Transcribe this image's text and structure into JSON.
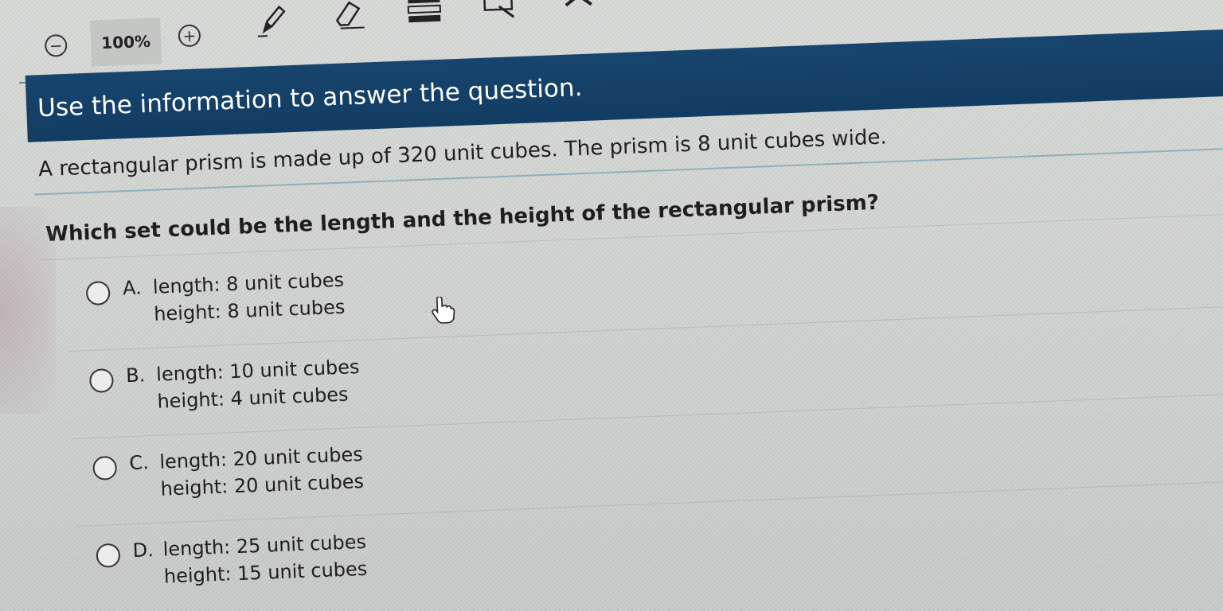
{
  "toolbar": {
    "zoom_level": "100%",
    "zoom_out_symbol": "−",
    "zoom_in_symbol": "+",
    "tools": [
      "pencil-icon",
      "eraser-icon",
      "line-reader-icon",
      "annotate-icon",
      "close-icon"
    ]
  },
  "banner": {
    "text": "Use the information to answer the question."
  },
  "info": {
    "text": "A rectangular prism is made up of 320 unit cubes. The prism is 8 unit cubes wide."
  },
  "question": {
    "text": "Which set could be the length and the height of the rectangular prism?"
  },
  "choices": [
    {
      "letter": "A.",
      "line1": "length: 8 unit cubes",
      "line2": "height: 8 unit cubes"
    },
    {
      "letter": "B.",
      "line1": "length: 10 unit cubes",
      "line2": "height: 4 unit cubes"
    },
    {
      "letter": "C.",
      "line1": "length: 20 unit cubes",
      "line2": "height: 20 unit cubes"
    },
    {
      "letter": "D.",
      "line1": "length: 25 unit cubes",
      "line2": "height: 15 unit cubes"
    }
  ],
  "colors": {
    "banner": "#17456e",
    "rule_accent": "#5b8fa0"
  }
}
